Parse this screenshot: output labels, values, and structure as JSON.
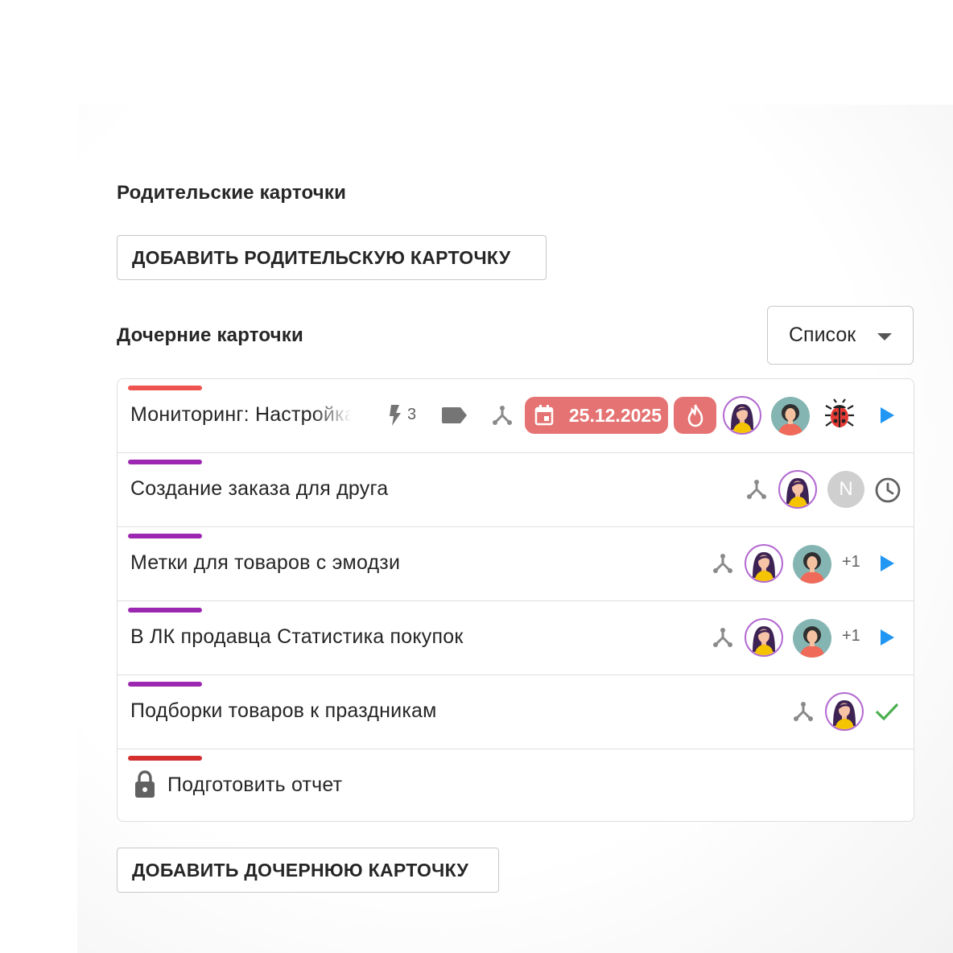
{
  "parent_section": {
    "title": "Родительские карточки",
    "add_button": "ДОБАВИТЬ РОДИТЕЛЬСКУЮ КАРТОЧКУ"
  },
  "child_section": {
    "title": "Дочерние карточки",
    "view_select": {
      "selected": "Список"
    },
    "add_button": "ДОБАВИТЬ ДОЧЕРНЮЮ КАРТОЧКУ"
  },
  "colors": {
    "stripe_red": "#ef5350",
    "stripe_purple": "#9c27b0",
    "stripe_darkred": "#d32f2f",
    "badge_red": "#e57373",
    "accent_blue": "#2196f3",
    "check_green": "#4caf50"
  },
  "cards": [
    {
      "title": "Мониторинг: Настройка",
      "stripe": "red",
      "subtask_count": "3",
      "due_date": "25.12.2025",
      "icons": [
        "bolt-icon",
        "tag-icon",
        "subtask-tree-icon",
        "calendar-icon",
        "fire-icon",
        "avatar",
        "avatar",
        "bug-icon",
        "play-icon"
      ]
    },
    {
      "title": "Создание заказа для друга",
      "stripe": "purple",
      "n_avatar": "N",
      "icons": [
        "subtask-tree-icon",
        "avatar",
        "avatar-initial",
        "clock-icon"
      ]
    },
    {
      "title": "Метки для товаров с эмодзи",
      "stripe": "purple",
      "extra_members": "+1",
      "icons": [
        "subtask-tree-icon",
        "avatar",
        "avatar",
        "play-icon"
      ]
    },
    {
      "title": "В ЛК продавца Статистика покупок",
      "stripe": "purple",
      "extra_members": "+1",
      "icons": [
        "subtask-tree-icon",
        "avatar",
        "avatar",
        "play-icon"
      ]
    },
    {
      "title": "Подборки товаров к праздникам",
      "stripe": "purple",
      "icons": [
        "subtask-tree-icon",
        "avatar",
        "check-icon"
      ]
    },
    {
      "title": "Подготовить отчет",
      "stripe": "darkred",
      "icons": [
        "lock-icon"
      ]
    }
  ]
}
